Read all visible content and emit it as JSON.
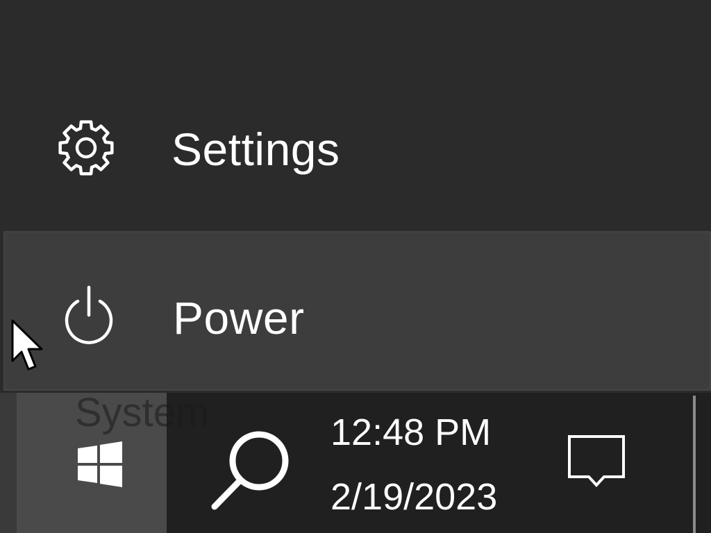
{
  "start_menu": {
    "settings_label": "Settings",
    "settings_icon": "gear-icon",
    "power_label": "Power",
    "power_icon": "power-icon"
  },
  "tooltip": {
    "text": "System"
  },
  "taskbar": {
    "start_icon": "windows-logo-icon",
    "search_icon": "search-icon",
    "clock_time": "12:48 PM",
    "clock_date": "2/19/2023",
    "notification_icon": "action-center-icon"
  },
  "colors": {
    "menu_background": "#2b2b2b",
    "hover_background": "#3d3d3d",
    "taskbar_background": "#202020",
    "start_button_active": "#4a4a4a",
    "foreground": "#ffffff"
  }
}
